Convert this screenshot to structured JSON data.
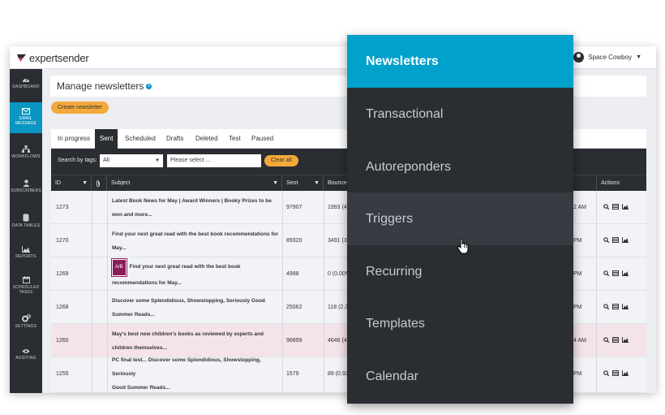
{
  "brand": {
    "name": "expertsender",
    "accent": "#0b96c2",
    "orange": "#f4a93b",
    "menu_accent": "#00a1cb"
  },
  "user": {
    "name": "Space Cowboy"
  },
  "sidebar": {
    "items": [
      {
        "label": "DASHBOARD",
        "icon": "dashboard-icon"
      },
      {
        "label": "EMAIL MESSAGE",
        "icon": "envelope-icon",
        "active": true
      },
      {
        "label": "WORKFLOWS",
        "icon": "workflow-icon"
      },
      {
        "label": "SUBSCRIBERS",
        "icon": "user-icon"
      },
      {
        "label": "DATA TABLES",
        "icon": "database-icon"
      },
      {
        "label": "REPORTS",
        "icon": "chart-icon"
      },
      {
        "label": "SCHEDULED TASKS",
        "icon": "calendar-icon"
      },
      {
        "label": "SETTINGS",
        "icon": "gears-icon"
      },
      {
        "label": "AUDITING",
        "icon": "eye-icon"
      }
    ]
  },
  "page": {
    "title": "Manage newsletters",
    "create_label": "Create newsletter"
  },
  "tabs": [
    "In progress",
    "Sent",
    "Scheduled",
    "Drafts",
    "Deleted",
    "Test",
    "Paused"
  ],
  "active_tab": "Sent",
  "filters": {
    "label": "Search by tags:",
    "select_value": "All",
    "tag_placeholder": "Please select ...",
    "clear_label": "Clear all"
  },
  "table": {
    "columns": [
      "ID",
      "Subject",
      "Sent",
      "Bounces",
      "Actions"
    ],
    "rows": [
      {
        "id": "1273",
        "subject_1": "Latest Book News for May | Award Winners | Booky Prizes to be",
        "subject_2": "won and more...",
        "sent": "97907",
        "bounces": "1993 (4.",
        "time": "2 AM"
      },
      {
        "id": "1270",
        "subject_1": "Find your next great read with the best book recommendations for",
        "subject_2": "May...",
        "sent": "89320",
        "bounces": "3491 (3.",
        "time": "PM"
      },
      {
        "id": "1269",
        "ab": "A/B",
        "subject_1": "Find your next great read with the best book",
        "subject_2": "recommendations for May...",
        "sent": "4998",
        "bounces": "0 (0.00%",
        "time": "PM"
      },
      {
        "id": "1268",
        "subject_1": "Discover some Splendidious, Showstopping, Seriously Good",
        "subject_2": "Summer Reads...",
        "sent": "25062",
        "bounces": "118 (2.3",
        "time": "PM"
      },
      {
        "id": "1260",
        "subject_1": "May's best new children's books as reviewed by experts and",
        "subject_2": "children themselves...",
        "sent": "96899",
        "bounces": "4646 (4.",
        "time": "4 AM"
      },
      {
        "id": "1255",
        "subject_1": "PC final test... Discover some Splendidious, Showstopping, Seriously",
        "subject_2": "Good Summer Reads...",
        "sent": "1579",
        "bounces": "89 (0.92",
        "time": "PM"
      }
    ]
  },
  "menu": {
    "items": [
      "Newsletters",
      "Transactional",
      "Autoreponders",
      "Triggers",
      "Recurring",
      "Templates",
      "Calendar"
    ],
    "active": "Newsletters",
    "hover": "Triggers"
  }
}
